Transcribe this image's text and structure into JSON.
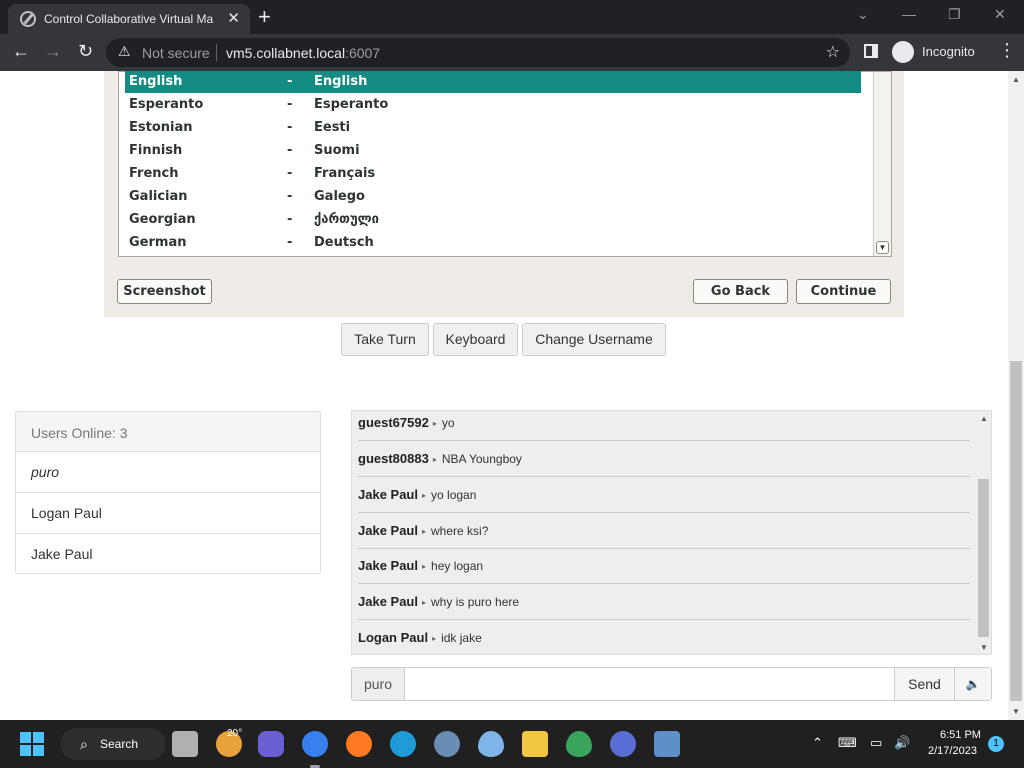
{
  "browser": {
    "tab_title": "Control Collaborative Virtual Ma",
    "not_secure": "Not secure",
    "url_host": "vm5.collabnet.local",
    "url_port": ":6007",
    "incognito": "Incognito"
  },
  "installer": {
    "languages": [
      {
        "name": "English",
        "dash": "-",
        "native": "English",
        "selected": true
      },
      {
        "name": "Esperanto",
        "dash": "-",
        "native": "Esperanto"
      },
      {
        "name": "Estonian",
        "dash": "-",
        "native": "Eesti"
      },
      {
        "name": "Finnish",
        "dash": "-",
        "native": "Suomi"
      },
      {
        "name": "French",
        "dash": "-",
        "native": "Français"
      },
      {
        "name": "Galician",
        "dash": "-",
        "native": "Galego"
      },
      {
        "name": "Georgian",
        "dash": "-",
        "native": "ქართული"
      },
      {
        "name": "German",
        "dash": "-",
        "native": "Deutsch"
      }
    ],
    "screenshot_label": "Screenshot",
    "go_back_label": "Go Back",
    "continue_label": "Continue",
    "selected_color": "#158c83"
  },
  "controls": {
    "take_turn": "Take Turn",
    "keyboard": "Keyboard",
    "change_username": "Change Username"
  },
  "users": {
    "header": "Users Online: 3",
    "list": [
      "puro",
      "Logan Paul",
      "Jake Paul"
    ]
  },
  "chat": {
    "messages": [
      {
        "user": "guest67592",
        "text": "yo"
      },
      {
        "user": "guest80883",
        "text": "NBA Youngboy"
      },
      {
        "user": "Jake Paul",
        "text": "yo logan"
      },
      {
        "user": "Jake Paul",
        "text": "where ksi?"
      },
      {
        "user": "Jake Paul",
        "text": "hey logan"
      },
      {
        "user": "Jake Paul",
        "text": "why is puro here"
      },
      {
        "user": "Logan Paul",
        "text": "idk jake"
      }
    ],
    "username": "puro",
    "input_value": "",
    "send_label": "Send"
  },
  "taskbar": {
    "search_label": "Search",
    "weather_temp": "20°",
    "time": "6:51 PM",
    "date": "2/17/2023",
    "notification_count": "1",
    "accent_color": "#4cc2ff"
  }
}
